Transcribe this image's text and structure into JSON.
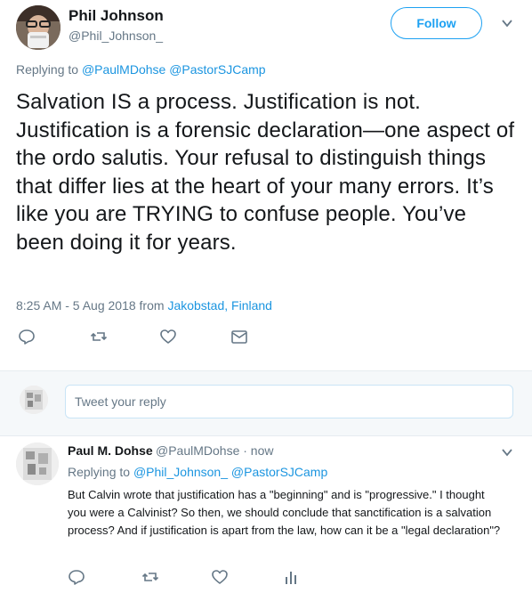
{
  "tweet": {
    "author_name": "Phil Johnson",
    "author_handle": "@Phil_Johnson_",
    "follow_label": "Follow",
    "replying_prefix": "Replying to",
    "replying_to_1": "@PaulMDohse",
    "replying_to_2": "@PastorSJCamp",
    "text": "Salvation IS a process. Justification is not. Justification is a forensic declaration—one aspect of the ordo salutis. Your refusal to distinguish things that differ lies at the heart of your many errors. It’s like you are TRYING to confuse people. You’ve been doing it for years.",
    "time": "8:25 AM - 5 Aug 2018 from",
    "location": "Jakobstad, Finland",
    "actions": [
      "reply-icon",
      "retweet-icon",
      "like-icon",
      "message-icon"
    ]
  },
  "reply_box": {
    "placeholder": "Tweet your reply"
  },
  "reply": {
    "author_name": "Paul M. Dohse",
    "author_handle": "@PaulMDohse · now",
    "replying_prefix": "Replying to",
    "replying_to_1": "@Phil_Johnson_",
    "replying_to_2": "@PastorSJCamp",
    "text": "But Calvin wrote that justification has a \"beginning\" and is \"progressive.\" I thought you were a Calvinist? So then, we should conclude that sanctification is a salvation process? And if justification is apart from the law, how can it be a \"legal declaration\"?",
    "actions": [
      "reply-icon",
      "retweet-icon",
      "like-icon",
      "analytics-icon"
    ]
  },
  "colors": {
    "accent": "#1da1f2",
    "link": "#1b95e0",
    "muted": "#657786",
    "text": "#14171a"
  }
}
